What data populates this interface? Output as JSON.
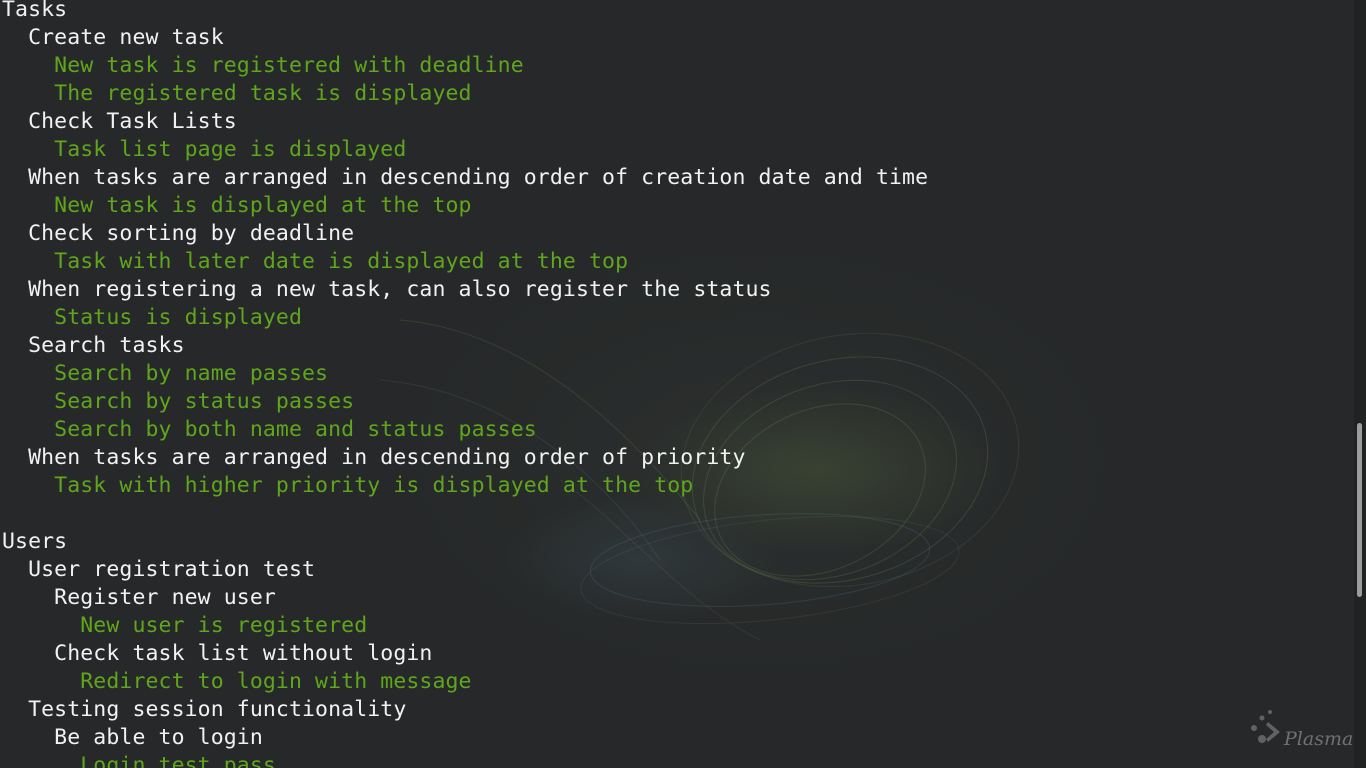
{
  "terminal": {
    "lines": [
      {
        "text": "Tasks",
        "kind": "heading"
      },
      {
        "text": "  Create new task",
        "kind": "heading"
      },
      {
        "text": "    New task is registered with deadline",
        "kind": "pass"
      },
      {
        "text": "    The registered task is displayed",
        "kind": "pass"
      },
      {
        "text": "  Check Task Lists",
        "kind": "heading"
      },
      {
        "text": "    Task list page is displayed",
        "kind": "pass"
      },
      {
        "text": "  When tasks are arranged in descending order of creation date and time",
        "kind": "heading"
      },
      {
        "text": "    New task is displayed at the top",
        "kind": "pass"
      },
      {
        "text": "  Check sorting by deadline",
        "kind": "heading"
      },
      {
        "text": "    Task with later date is displayed at the top",
        "kind": "pass"
      },
      {
        "text": "  When registering a new task, can also register the status",
        "kind": "heading"
      },
      {
        "text": "    Status is displayed",
        "kind": "pass"
      },
      {
        "text": "  Search tasks",
        "kind": "heading"
      },
      {
        "text": "    Search by name passes",
        "kind": "pass"
      },
      {
        "text": "    Search by status passes",
        "kind": "pass"
      },
      {
        "text": "    Search by both name and status passes",
        "kind": "pass"
      },
      {
        "text": "  When tasks are arranged in descending order of priority",
        "kind": "heading"
      },
      {
        "text": "    Task with higher priority is displayed at the top",
        "kind": "pass"
      },
      {
        "text": "",
        "kind": "blank"
      },
      {
        "text": "Users",
        "kind": "heading"
      },
      {
        "text": "  User registration test",
        "kind": "heading"
      },
      {
        "text": "    Register new user",
        "kind": "heading"
      },
      {
        "text": "      New user is registered",
        "kind": "pass"
      },
      {
        "text": "    Check task list without login",
        "kind": "heading"
      },
      {
        "text": "      Redirect to login with message",
        "kind": "pass"
      },
      {
        "text": "  Testing session functionality",
        "kind": "heading"
      },
      {
        "text": "    Be able to login",
        "kind": "heading"
      },
      {
        "text": "      Login test pass",
        "kind": "pass"
      }
    ]
  },
  "wallpaper": {
    "brand": "Plasma",
    "logo_icon": "plasma-logo-icon"
  },
  "colors": {
    "background": "#262829",
    "heading_text": "#f2f2f2",
    "pass_text": "#5fa61c",
    "scrollbar_thumb": "#9a9c9d"
  }
}
